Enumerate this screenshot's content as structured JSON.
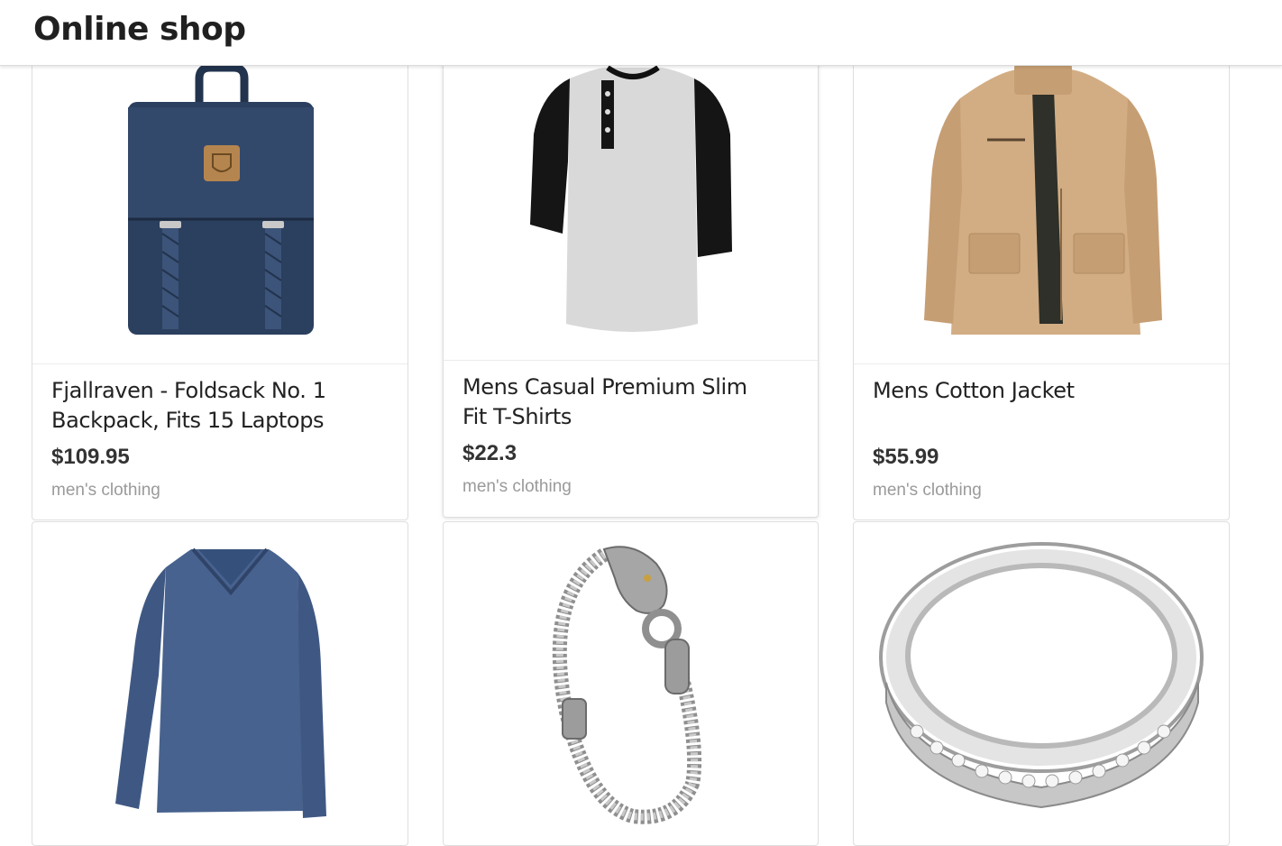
{
  "header": {
    "title": "Online shop"
  },
  "products": [
    {
      "title": "Fjallraven - Foldsack No. 1 Backpack, Fits 15 Laptops",
      "price": "$109.95",
      "category": "men's clothing",
      "image_icon": "backpack-image"
    },
    {
      "title": "Mens Casual Premium Slim Fit T-Shirts",
      "price": "$22.3",
      "category": "men's clothing",
      "image_icon": "tshirt-image"
    },
    {
      "title": "Mens Cotton Jacket",
      "price": "$55.99",
      "category": "men's clothing",
      "image_icon": "jacket-image"
    },
    {
      "title": "",
      "price": "",
      "category": "",
      "image_icon": "long-sleeve-shirt-image"
    },
    {
      "title": "",
      "price": "",
      "category": "",
      "image_icon": "bracelet-image"
    },
    {
      "title": "",
      "price": "",
      "category": "",
      "image_icon": "ring-image"
    }
  ],
  "colors": {
    "backpack": "#2b3f5e",
    "tshirt_body": "#d9d9d9",
    "tshirt_sleeves": "#151515",
    "jacket": "#d2ad84",
    "long_sleeve": "#47628e",
    "silver": "#b5b5b5"
  }
}
